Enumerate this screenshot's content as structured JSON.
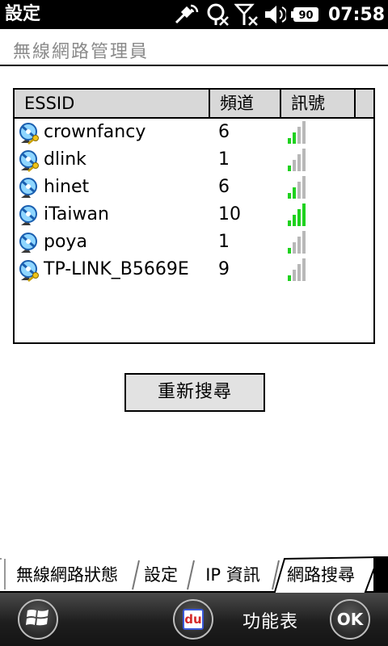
{
  "status_bar": {
    "app_title": "設定",
    "clock": "07:58",
    "battery_text": "90",
    "icons": [
      "satellite-signal-icon",
      "sync-off-icon",
      "no-signal-icon",
      "volume-icon",
      "battery-icon"
    ]
  },
  "header": {
    "title": "無線網路管理員"
  },
  "network_list": {
    "columns": {
      "essid": "ESSID",
      "channel": "頻道",
      "signal": "訊號"
    },
    "rows": [
      {
        "essid": "crownfancy",
        "channel": "6",
        "secured": true,
        "signal_bars": 2
      },
      {
        "essid": "dlink",
        "channel": "1",
        "secured": true,
        "signal_bars": 1
      },
      {
        "essid": "hinet",
        "channel": "6",
        "secured": false,
        "signal_bars": 2
      },
      {
        "essid": "iTaiwan",
        "channel": "10",
        "secured": false,
        "signal_bars": 4
      },
      {
        "essid": "poya",
        "channel": "1",
        "secured": false,
        "signal_bars": 1
      },
      {
        "essid": "TP-LINK_B5669E",
        "channel": "9",
        "secured": true,
        "signal_bars": 1
      }
    ]
  },
  "refresh_button": {
    "label": "重新搜尋"
  },
  "tabs": [
    {
      "label": "無線網路狀態",
      "active": false
    },
    {
      "label": "設定",
      "active": false
    },
    {
      "label": "IP 資訊",
      "active": false
    },
    {
      "label": "網路搜尋",
      "active": true
    }
  ],
  "bottom_bar": {
    "menu_label": "功能表",
    "ok_label": "OK",
    "app_icon_text": "du"
  },
  "colors": {
    "signal_on": "#1fd21f",
    "signal_off": "#b8b8b8",
    "header_bg": "#d8d8d8"
  }
}
